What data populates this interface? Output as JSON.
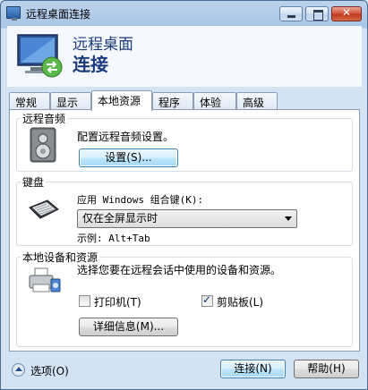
{
  "window": {
    "title": "远程桌面连接"
  },
  "banner": {
    "line1": "远程桌面",
    "line2": "连接"
  },
  "tabs": [
    {
      "label": "常规"
    },
    {
      "label": "显示"
    },
    {
      "label": "本地资源"
    },
    {
      "label": "程序"
    },
    {
      "label": "体验"
    },
    {
      "label": "高级"
    }
  ],
  "audio": {
    "legend": "远程音频",
    "description": "配置远程音频设置。",
    "settings_button": "设置(S)..."
  },
  "keyboard": {
    "legend": "键盘",
    "prompt": "应用 Windows 组合键(K):",
    "selected": "仅在全屏显示时",
    "example": "示例: Alt+Tab"
  },
  "devices": {
    "legend": "本地设备和资源",
    "description": "选择您要在远程会话中使用的设备和资源。",
    "printer_label": "打印机(T)",
    "printer_checked": false,
    "clipboard_label": "剪贴板(L)",
    "clipboard_checked": true,
    "details_button": "详细信息(M)..."
  },
  "footer": {
    "options_label": "选项(O)",
    "connect_button": "连接(N)",
    "help_button": "帮助(H)"
  }
}
